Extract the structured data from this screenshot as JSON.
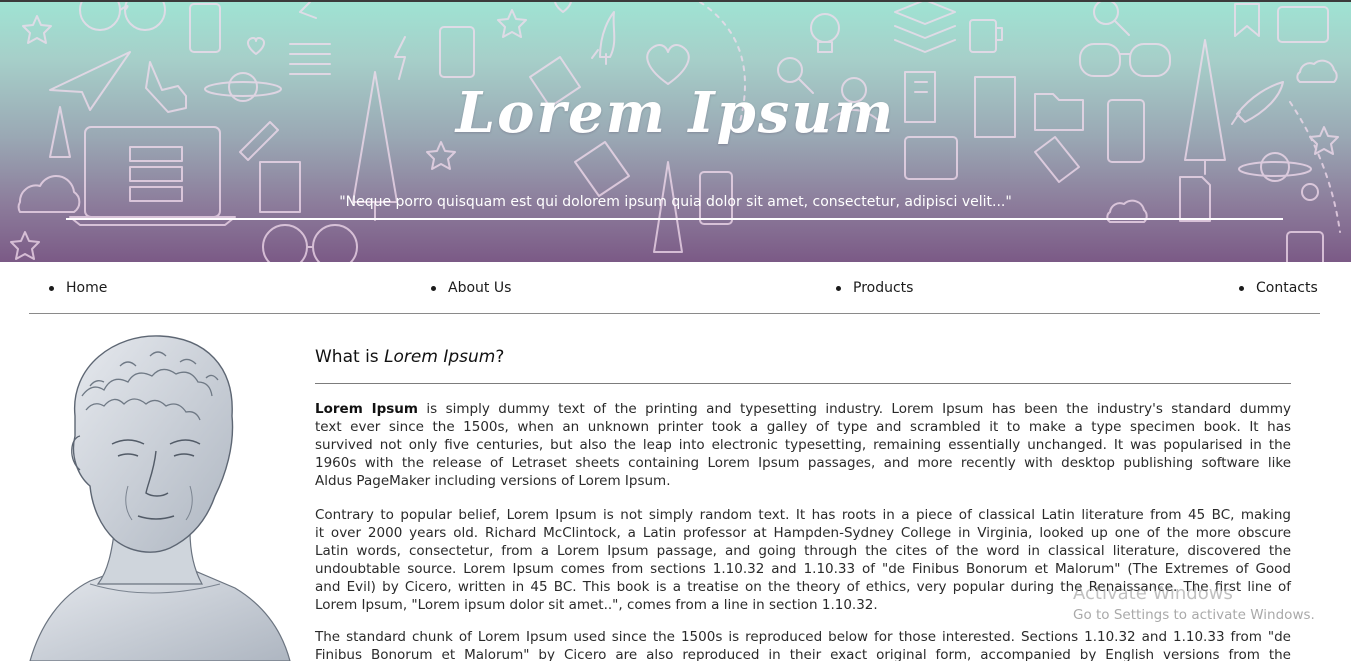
{
  "header": {
    "title": "Lorem Ipsum",
    "quote": "\"Neque porro quisquam est qui dolorem ipsum quia dolor sit amet, consectetur, adipisci velit...\""
  },
  "nav": {
    "items": [
      {
        "label": "Home"
      },
      {
        "label": "About Us"
      },
      {
        "label": "Products"
      },
      {
        "label": "Contacts"
      }
    ]
  },
  "article": {
    "heading_prefix": "What is ",
    "heading_em": "Lorem Ipsum",
    "heading_suffix": "?",
    "p1": {
      "strong": "Lorem Ipsum",
      "lines": [
        " is simply dummy text of the printing and typesetting industry. Lorem Ipsum has been the industry's standard dummy",
        "text ever since the 1500s, when an unknown printer took a galley of type and scrambled it to make a type specimen book. It has",
        "survived not only five centuries, but also the leap into electronic typesetting, remaining essentially unchanged. It was popularised in the",
        "1960s with the release of Letraset sheets containing Lorem Ipsum passages, and more recently with desktop publishing software like",
        "Aldus PageMaker including versions of Lorem Ipsum."
      ]
    },
    "p2": {
      "lines": [
        "Contrary to popular belief, Lorem Ipsum is not simply random text. It has roots in a piece of classical Latin literature from 45 BC, making",
        "it over 2000 years old. Richard McClintock, a Latin professor at Hampden-Sydney College in Virginia, looked up one of the more obscure",
        "Latin words, consectetur, from a Lorem Ipsum passage, and going through the cites of the word in classical literature, discovered the",
        "undoubtable source. Lorem Ipsum comes from sections 1.10.32 and 1.10.33 of \"de Finibus Bonorum et Malorum\" (The Extremes of Good",
        "and Evil) by Cicero, written in 45 BC. This book is a treatise on the theory of ethics, very popular during the Renaissance. The first line of",
        "Lorem Ipsum, \"Lorem ipsum dolor sit amet..\", comes from a line in section 1.10.32."
      ]
    },
    "p3": {
      "lines": [
        "The standard chunk of Lorem Ipsum used since the 1500s is reproduced below for those interested. Sections 1.10.32 and 1.10.33 from \"de",
        "Finibus Bonorum et Malorum\" by Cicero are also reproduced in their exact original form, accompanied by English versions from the"
      ]
    }
  },
  "watermark": {
    "title": "Activate Windows",
    "subtitle": "Go to Settings to activate Windows."
  },
  "colors": {
    "banner_top": "#9fe3d3",
    "banner_bottom": "#7b5a86",
    "doodle_stroke": "#f3dcee",
    "text": "#2a2a2a"
  },
  "icons": [
    "rocket-icon",
    "heart-icon",
    "star-icon",
    "lightbulb-icon",
    "glasses-icon",
    "magnifier-icon",
    "cloud-icon",
    "laptop-icon",
    "phone-icon",
    "coffee-cup-icon",
    "tree-icon",
    "planet-icon",
    "paper-plane-icon",
    "folder-icon",
    "document-icon",
    "gear-icon"
  ]
}
